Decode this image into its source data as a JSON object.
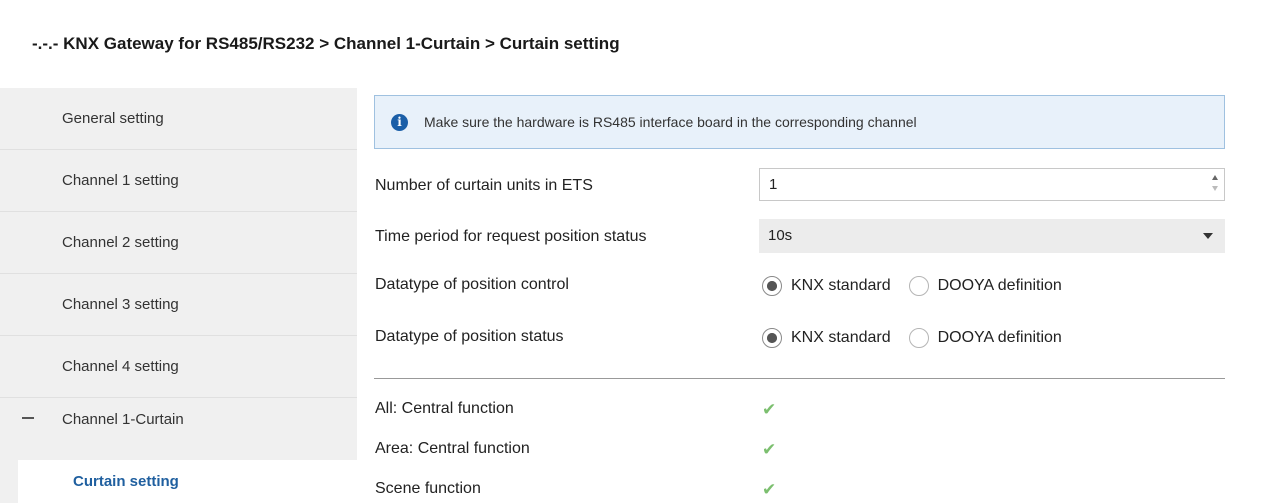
{
  "breadcrumb": "-.-.- KNX Gateway for RS485/RS232 > Channel 1-Curtain > Curtain setting",
  "sidebar": {
    "items": [
      {
        "label": "General setting"
      },
      {
        "label": "Channel 1 setting"
      },
      {
        "label": "Channel 2 setting"
      },
      {
        "label": "Channel 3 setting"
      },
      {
        "label": "Channel 4 setting"
      },
      {
        "label": "Channel 1-Curtain"
      }
    ],
    "sub_item": "Curtain setting"
  },
  "info": {
    "icon": "info-icon",
    "icon_glyph": "i",
    "text": "Make sure the hardware is RS485 interface board in the corresponding channel"
  },
  "params": {
    "units_label": "Number of curtain units in ETS",
    "units_value": "1",
    "period_label": "Time period for request position status",
    "period_value": "10s",
    "pos_control_label": "Datatype of position control",
    "pos_status_label": "Datatype of position status",
    "opt_knx": "KNX standard",
    "opt_dooya": "DOOYA definition",
    "pos_control_selected": "KNX standard",
    "pos_status_selected": "KNX standard"
  },
  "functions": [
    {
      "label": "All: Central function",
      "checked": true
    },
    {
      "label": "Area: Central function",
      "checked": true
    },
    {
      "label": "Scene function",
      "checked": true
    }
  ],
  "colors": {
    "accent": "#1f5f9f",
    "info_bg": "#e8f1fa",
    "check": "#7cbf6f",
    "sidebar_bg": "#f0f0f0"
  }
}
